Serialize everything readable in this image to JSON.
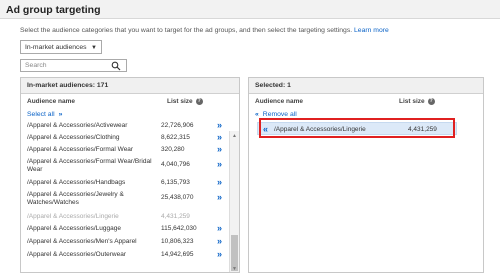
{
  "header": {
    "title": "Ad group targeting"
  },
  "intro": {
    "text": "Select the audience categories that you want to target for the ad groups, and then select the targeting settings. ",
    "link": "Learn more"
  },
  "dropdown": {
    "value": "In-market audiences"
  },
  "search": {
    "placeholder": "Search"
  },
  "left_panel": {
    "title": "In-market audiences:  171",
    "col_name": "Audience name",
    "col_size": "List size",
    "select_all": "Select all",
    "rows": [
      {
        "name": "/Apparel & Accessories/Activewear",
        "size": "22,726,906"
      },
      {
        "name": "/Apparel & Accessories/Clothing",
        "size": "8,622,315"
      },
      {
        "name": "/Apparel & Accessories/Formal Wear",
        "size": "320,280"
      },
      {
        "name": "/Apparel & Accessories/Formal Wear/Bridal Wear",
        "size": "4,040,796"
      },
      {
        "name": "/Apparel & Accessories/Handbags",
        "size": "6,135,793"
      },
      {
        "name": "/Apparel & Accessories/Jewelry & Watches/Watches",
        "size": "25,438,070"
      },
      {
        "name": "/Apparel & Accessories/Lingerie",
        "size": "4,431,259",
        "disabled": true
      },
      {
        "name": "/Apparel & Accessories/Luggage",
        "size": "115,642,030"
      },
      {
        "name": "/Apparel & Accessories/Men's Apparel",
        "size": "10,806,323"
      },
      {
        "name": "/Apparel & Accessories/Outerwear",
        "size": "14,942,695"
      }
    ]
  },
  "right_panel": {
    "title": "Selected:  1",
    "col_name": "Audience name",
    "col_size": "List size",
    "remove_all": "Remove all",
    "selected": {
      "name": "/Apparel & Accessories/Lingerie",
      "size": "4,431,259"
    }
  },
  "colors": {
    "link": "#0b63c7",
    "highlight": "#e02020",
    "selected_bg": "#dce9f8"
  }
}
